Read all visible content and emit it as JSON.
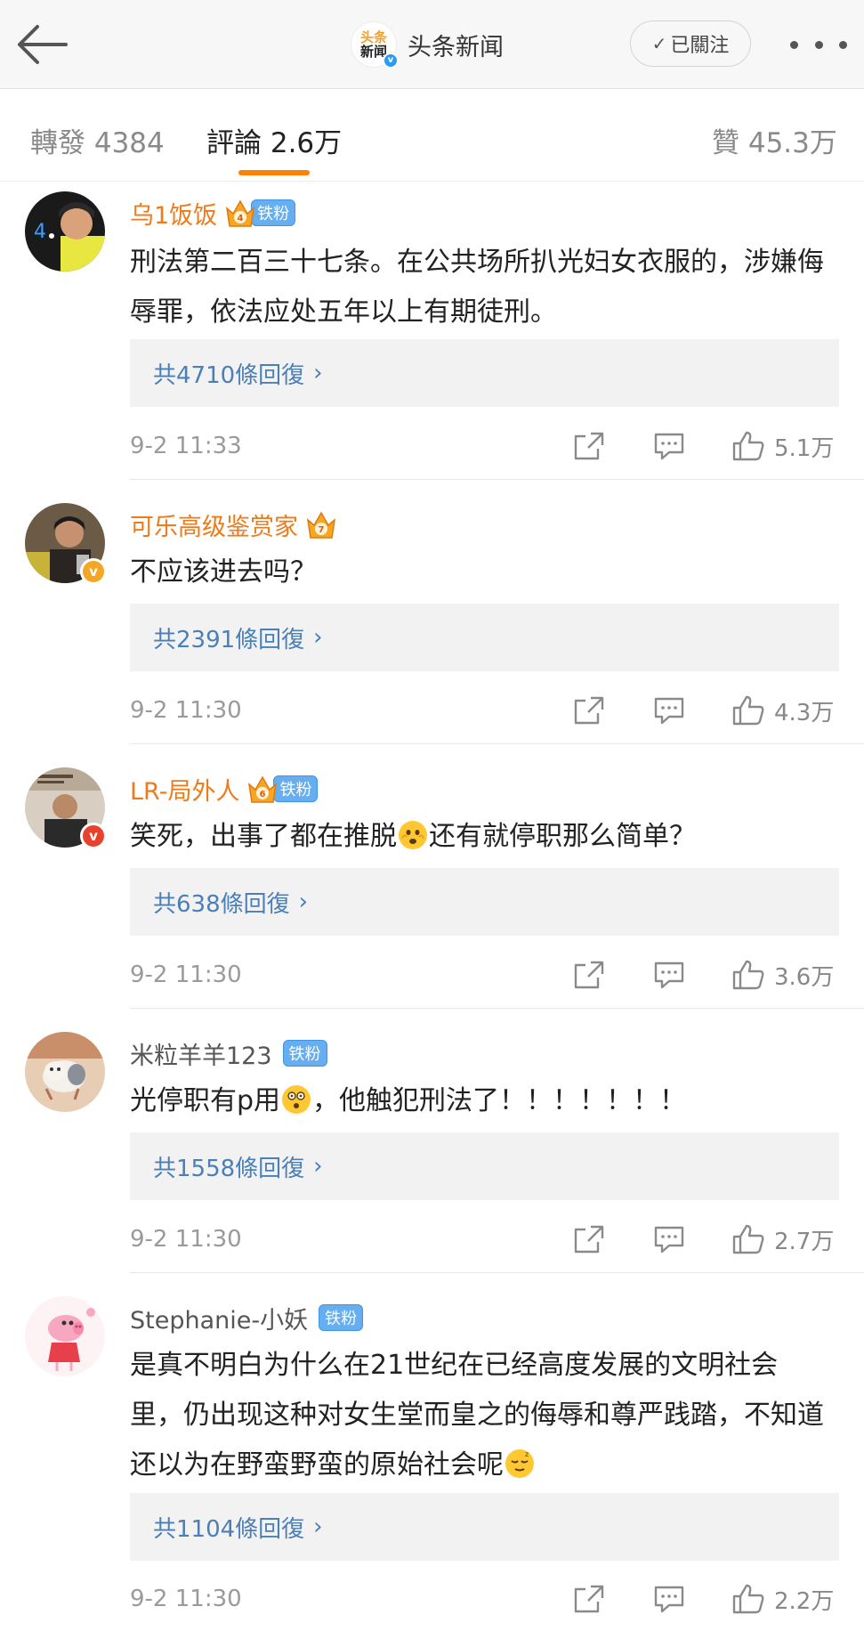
{
  "header": {
    "back_icon": "back-arrow-icon",
    "logo_line1": "头条",
    "logo_line2": "新闻",
    "account_name": "头条新闻",
    "follow_label": "已關注",
    "more_icon": "more-dots-icon"
  },
  "tabs": {
    "forward": "轉發 4384",
    "comments": "評論 2.6万",
    "likes": "贊 45.3万",
    "active": "comments",
    "accent": "#ff8200"
  },
  "colors": {
    "vip_name": "#ee7a1a",
    "link": "#4a7fb8",
    "fan_tag": "#66aef0"
  },
  "fan_tag_label": "铁粉",
  "comments": [
    {
      "username": "乌1饭饭",
      "vip": true,
      "crown_level": "4",
      "fan_tag": true,
      "text": "刑法第二百三十七条。在公共场所扒光妇女衣服的，涉嫌侮辱罪，依法应处五年以上有期徒刑。",
      "replies": "共4710條回復",
      "time": "9-2 11:33",
      "likes": "5.1万"
    },
    {
      "username": "可乐高级鉴赏家",
      "vip": true,
      "crown_level": "7",
      "fan_tag": false,
      "verified": "gold",
      "text": "不应该进去吗？",
      "replies": "共2391條回復",
      "time": "9-2 11:30",
      "likes": "4.3万"
    },
    {
      "username": "LR-局外人",
      "vip": true,
      "crown_level": "6",
      "fan_tag": true,
      "verified": "red",
      "text_before": "笑死，出事了都在推脱",
      "emoji": "scared-face-emoji",
      "text_after": "还有就停职那么简单？",
      "replies": "共638條回復",
      "time": "9-2 11:30",
      "likes": "3.6万"
    },
    {
      "username": "米粒羊羊123",
      "vip": false,
      "fan_tag": true,
      "text_before": "光停职有p用",
      "emoji": "shocked-face-emoji",
      "text_after": "，他触犯刑法了！！！！！！！",
      "replies": "共1558條回復",
      "time": "9-2 11:30",
      "likes": "2.7万"
    },
    {
      "username": "Stephanie-小妖",
      "vip": false,
      "fan_tag": true,
      "text_before": "是真不明白为什么在21世纪在已经高度发展的文明社会里，仍出现这种对女生堂而皇之的侮辱和尊严践踏，不知道还以为在野蛮野蛮的原始社会呢",
      "emoji": "sleepy-face-emoji",
      "text_after": "",
      "replies": "共1104條回復",
      "time": "9-2 11:30",
      "likes": "2.2万"
    }
  ]
}
